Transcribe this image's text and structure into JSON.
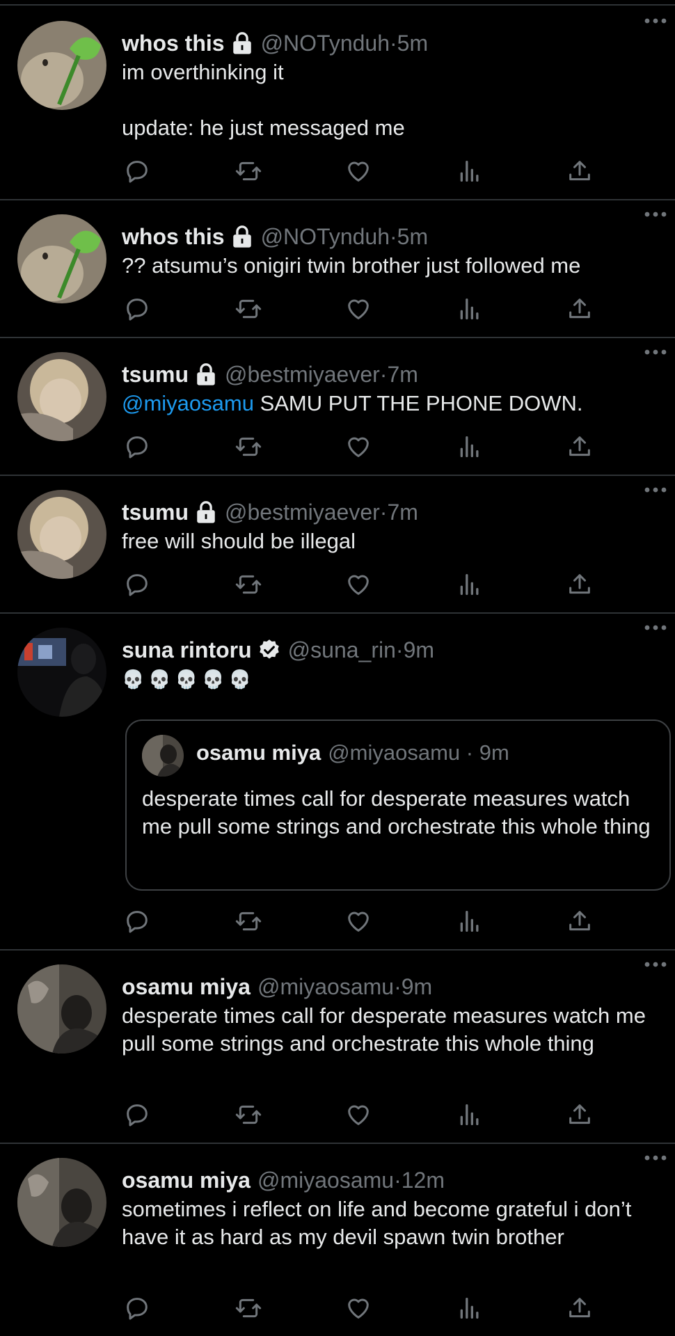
{
  "tweets": [
    {
      "name": "whos this",
      "handle": "@NOTynduh",
      "time": "5m",
      "text": "im overthinking it\n\nupdate: he just messaged me",
      "badge": "lock-icon",
      "avatar": "clover-plush-avatar"
    },
    {
      "name": "whos this",
      "handle": "@NOTynduh",
      "time": "5m",
      "text": "?? atsumu’s onigiri twin brother just followed me",
      "badge": "lock-icon",
      "avatar": "clover-plush-avatar"
    },
    {
      "name": "tsumu",
      "handle": "@bestmiyaever",
      "time": "7m",
      "mention": "@miyaosamu",
      "text": " SAMU PUT THE PHONE DOWN.",
      "badge": "lock-icon",
      "avatar": "blond-sleeping-avatar"
    },
    {
      "name": "tsumu",
      "handle": "@bestmiyaever",
      "time": "7m",
      "text": "free will should be illegal",
      "badge": "lock-icon",
      "avatar": "blond-sleeping-avatar"
    },
    {
      "name": "suna rintoru",
      "handle": "@suna_rin",
      "time": "9m",
      "text": "💀💀💀💀💀",
      "badge": "verified-icon",
      "avatar": "dark-car-avatar",
      "quote": {
        "name": "osamu miya",
        "handle": "@miyaosamu",
        "time": "9m",
        "text": "desperate times call for desperate measures watch me pull some strings and orchestrate this whole thing"
      }
    },
    {
      "name": "osamu miya",
      "handle": "@miyaosamu",
      "time": "9m",
      "text": "desperate times call for desperate measures watch me pull some strings and orchestrate this whole thing",
      "avatar": "dim-room-avatar"
    },
    {
      "name": "osamu miya",
      "handle": "@miyaosamu",
      "time": "12m",
      "text": "sometimes i reflect on life and become grateful i don’t have it as hard as my devil spawn twin brother",
      "avatar": "dim-room-avatar"
    }
  ],
  "meta": {
    "separator": " · "
  },
  "colors": {
    "background": "#000000",
    "text": "#e7e9ea",
    "muted": "#71767b",
    "link": "#1d9bf0",
    "divider": "#2f3336"
  }
}
